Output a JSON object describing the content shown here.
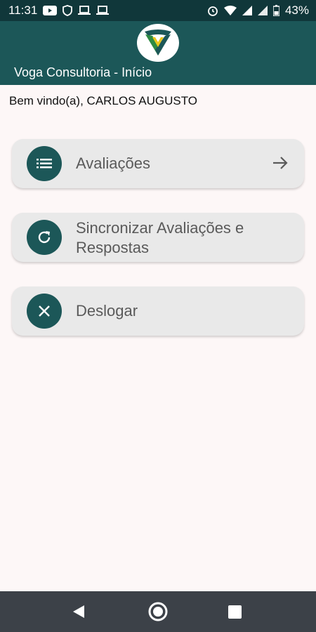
{
  "status_bar": {
    "time": "11:31",
    "battery": "43%",
    "left_icons": [
      "youtube-icon",
      "shield-icon",
      "laptop-icon",
      "laptop-icon"
    ],
    "right_icons": [
      "alarm-icon",
      "wifi-icon",
      "signal-icon",
      "signal-icon",
      "battery-icon"
    ]
  },
  "header": {
    "title": "Voga Consultoria - Início",
    "colors": {
      "bar": "#1c5758",
      "status": "#10373a"
    }
  },
  "welcome_text": "Bem vindo(a), CARLOS AUGUSTO",
  "menu": {
    "evaluations_label": "Avaliações",
    "sync_label_line1": "Sincronizar Avaliações e",
    "sync_label_line2": "Respostas",
    "logout_label": "Deslogar"
  },
  "nav": {
    "icons": [
      "back-icon",
      "home-icon",
      "recents-icon"
    ]
  },
  "colors": {
    "accent": "#1c5758",
    "button_bg": "#e9e9e9",
    "page_bg": "#fdf7f7"
  }
}
